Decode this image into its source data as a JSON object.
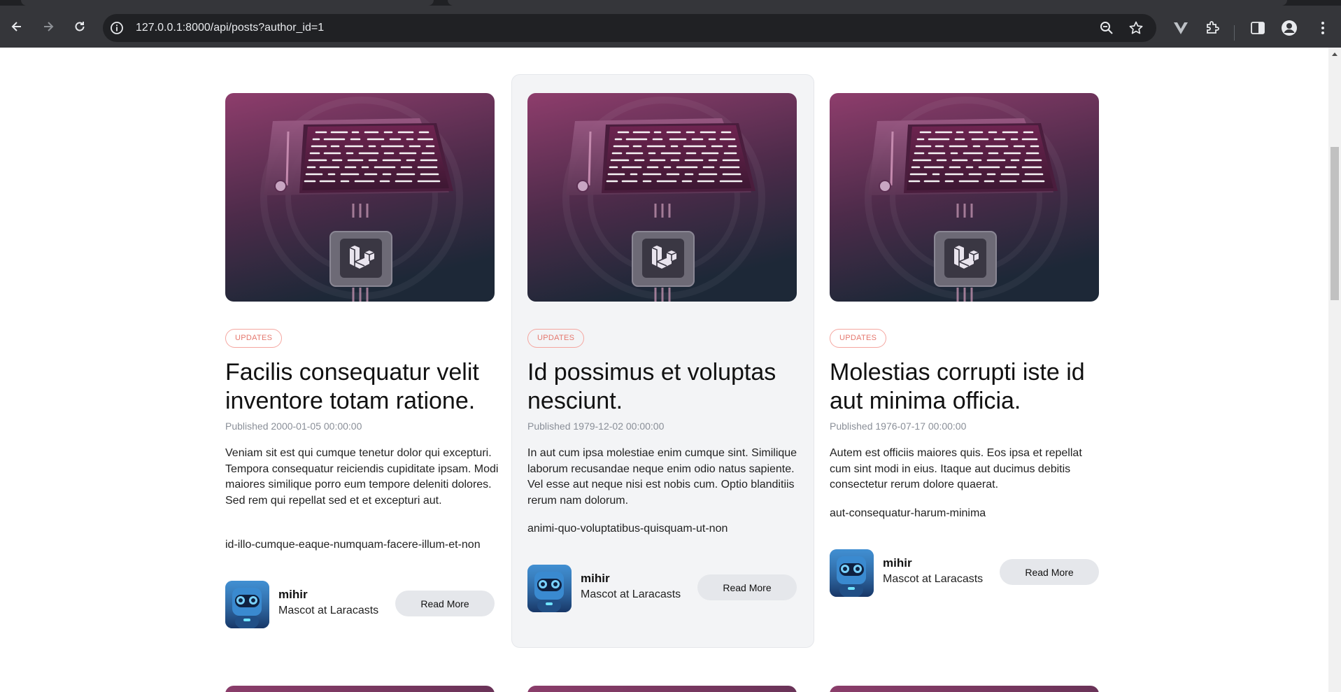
{
  "browser": {
    "url": "127.0.0.1:8000/api/posts?author_id=1"
  },
  "icons": {
    "back": "arrow-left-icon",
    "forward": "arrow-right-icon",
    "reload": "reload-icon",
    "site_info": "info-icon",
    "zoom": "zoom-icon",
    "bookmark": "star-icon",
    "extension_v": "vue-extension-icon",
    "extensions": "puzzle-icon",
    "side_panel": "side-panel-icon",
    "profile": "profile-icon",
    "menu": "kebab-menu-icon"
  },
  "colors": {
    "tag": "#e5786e",
    "card_image_top": "#8a3d6a",
    "card_image_bottom": "#1f2a3a",
    "featured_bg": "#f3f4f6"
  },
  "posts": [
    {
      "category": "UPDATES",
      "title": "Facilis consequatur velit inventore totam ratione.",
      "published": "Published 2000-01-05 00:00:00",
      "excerpt": "Veniam sit est qui cumque tenetur dolor qui excepturi. Tempora consequatur reiciendis cupiditate ipsam. Modi maiores similique porro eum tempore deleniti dolores. Sed rem qui repellat sed et et excepturi aut.",
      "slug": "id-illo-cumque-eaque-numquam-facere-illum-et-non",
      "author_name": "mihir",
      "author_role": "Mascot at Laracasts",
      "cta": "Read More"
    },
    {
      "category": "UPDATES",
      "title": "Id possimus et voluptas nesciunt.",
      "published": "Published 1979-12-02 00:00:00",
      "excerpt": "In aut cum ipsa molestiae enim cumque sint. Similique laborum recusandae neque enim odio natus sapiente. Vel esse aut neque nisi est nobis cum. Optio blanditiis rerum nam dolorum.",
      "slug": "animi-quo-voluptatibus-quisquam-ut-non",
      "author_name": "mihir",
      "author_role": "Mascot at Laracasts",
      "cta": "Read More"
    },
    {
      "category": "UPDATES",
      "title": "Molestias corrupti iste id aut minima officia.",
      "published": "Published 1976-07-17 00:00:00",
      "excerpt": "Autem est officiis maiores quis. Eos ipsa et repellat cum sint modi in eius. Itaque aut ducimus debitis consectetur rerum dolore quaerat.",
      "slug": "aut-consequatur-harum-minima",
      "author_name": "mihir",
      "author_role": "Mascot at Laracasts",
      "cta": "Read More"
    }
  ]
}
